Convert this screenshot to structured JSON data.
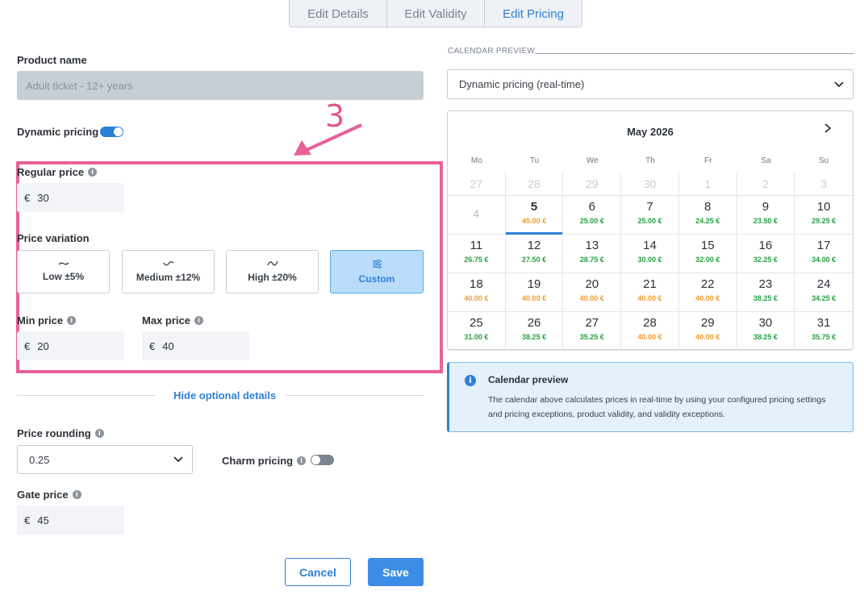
{
  "tabs": [
    {
      "label": "Edit Details",
      "active": false
    },
    {
      "label": "Edit Validity",
      "active": false
    },
    {
      "label": "Edit Pricing",
      "active": true
    }
  ],
  "product": {
    "label": "Product name",
    "value": "Adult ticket - 12+ years"
  },
  "dynamic_pricing": {
    "label": "Dynamic pricing",
    "enabled": true
  },
  "annotation": {
    "number": "3"
  },
  "regular_price": {
    "label": "Regular price",
    "currency": "€",
    "value": "30"
  },
  "price_variation": {
    "label": "Price variation",
    "options": [
      {
        "label": "Low ±5%",
        "icon": "wave-low-icon"
      },
      {
        "label": "Medium ±12%",
        "icon": "wave-medium-icon"
      },
      {
        "label": "High ±20%",
        "icon": "wave-high-icon"
      },
      {
        "label": "Custom",
        "icon": "sliders-icon",
        "active": true
      }
    ]
  },
  "min_price": {
    "label": "Min price",
    "currency": "€",
    "value": "20"
  },
  "max_price": {
    "label": "Max price",
    "currency": "€",
    "value": "40"
  },
  "optional_toggle": "Hide optional details",
  "price_rounding": {
    "label": "Price rounding",
    "value": "0.25"
  },
  "charm_pricing": {
    "label": "Charm pricing",
    "enabled": false
  },
  "gate_price": {
    "label": "Gate price",
    "currency": "€",
    "value": "45"
  },
  "actions": {
    "cancel": "Cancel",
    "save": "Save"
  },
  "calendar_preview": {
    "section_title": "CALENDAR PREVIEW",
    "mode_select": "Dynamic pricing (real-time)",
    "month": "May 2026",
    "weekdays": [
      "Mo",
      "Tu",
      "We",
      "Th",
      "Fr",
      "Sa",
      "Su"
    ],
    "leading_days": [
      "27",
      "28",
      "29",
      "30",
      "1",
      "2",
      "3"
    ],
    "weeks": [
      [
        {
          "day": "4",
          "price": "",
          "state": "past"
        },
        {
          "day": "5",
          "price": "45.00 €",
          "color": "orange",
          "today": true
        },
        {
          "day": "6",
          "price": "25.00 €",
          "color": "green"
        },
        {
          "day": "7",
          "price": "25.00 €",
          "color": "green"
        },
        {
          "day": "8",
          "price": "24.25 €",
          "color": "green"
        },
        {
          "day": "9",
          "price": "23.50 €",
          "color": "green"
        },
        {
          "day": "10",
          "price": "29.25 €",
          "color": "green"
        }
      ],
      [
        {
          "day": "11",
          "price": "26.75 €",
          "color": "green"
        },
        {
          "day": "12",
          "price": "27.50 €",
          "color": "green"
        },
        {
          "day": "13",
          "price": "28.75 €",
          "color": "green"
        },
        {
          "day": "14",
          "price": "30.00 €",
          "color": "green"
        },
        {
          "day": "15",
          "price": "32.00 €",
          "color": "green"
        },
        {
          "day": "16",
          "price": "32.25 €",
          "color": "green"
        },
        {
          "day": "17",
          "price": "34.00 €",
          "color": "green"
        }
      ],
      [
        {
          "day": "18",
          "price": "40.00 €",
          "color": "orange"
        },
        {
          "day": "19",
          "price": "40.00 €",
          "color": "orange"
        },
        {
          "day": "20",
          "price": "40.00 €",
          "color": "orange"
        },
        {
          "day": "21",
          "price": "40.00 €",
          "color": "orange"
        },
        {
          "day": "22",
          "price": "40.00 €",
          "color": "orange"
        },
        {
          "day": "23",
          "price": "38.25 €",
          "color": "green"
        },
        {
          "day": "24",
          "price": "34.25 €",
          "color": "green"
        }
      ],
      [
        {
          "day": "25",
          "price": "31.00 €",
          "color": "green"
        },
        {
          "day": "26",
          "price": "38.25 €",
          "color": "green"
        },
        {
          "day": "27",
          "price": "35.25 €",
          "color": "green"
        },
        {
          "day": "28",
          "price": "40.00 €",
          "color": "orange"
        },
        {
          "day": "29",
          "price": "40.00 €",
          "color": "orange"
        },
        {
          "day": "30",
          "price": "38.25 €",
          "color": "green"
        },
        {
          "day": "31",
          "price": "35.75 €",
          "color": "green"
        }
      ]
    ],
    "info_title": "Calendar preview",
    "info_text": "The calendar above calculates prices in real-time by using your configured pricing settings and pricing exceptions, product validity, and validity exceptions."
  },
  "colors": {
    "accent": "#2f7fd6",
    "highlight": "#e8609a",
    "price_green": "#25a140",
    "price_orange": "#f29a2e"
  }
}
